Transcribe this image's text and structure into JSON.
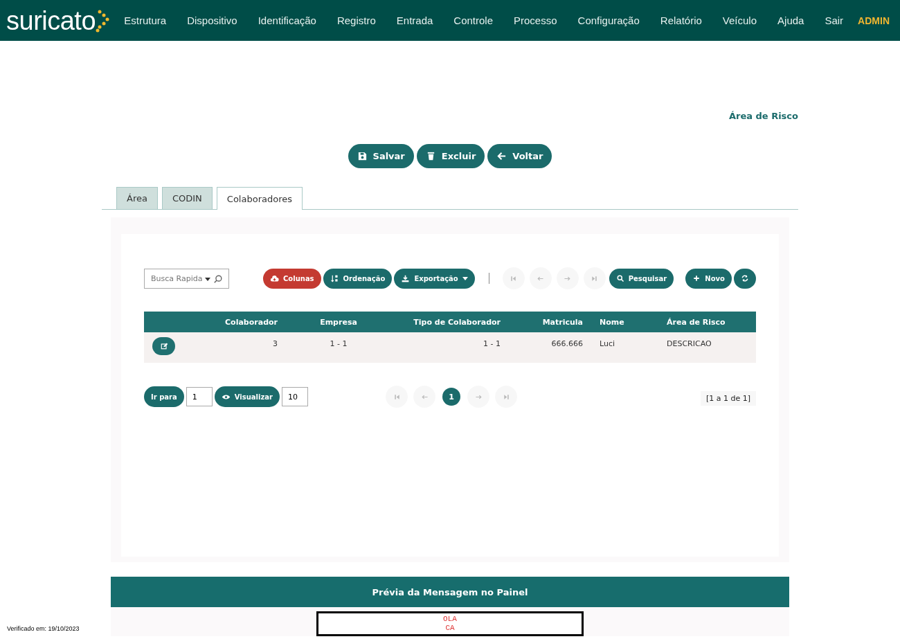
{
  "brand": {
    "name": "suricato"
  },
  "nav": [
    {
      "label": "Estrutura",
      "kind": "menu"
    },
    {
      "label": "Dispositivo",
      "kind": "menu"
    },
    {
      "label": "Identificação",
      "kind": "menu"
    },
    {
      "label": "Registro",
      "kind": "menu"
    },
    {
      "label": "Entrada",
      "kind": "menu"
    },
    {
      "label": "Controle",
      "kind": "menu"
    },
    {
      "label": "Processo",
      "kind": "menu"
    },
    {
      "label": "Configuração",
      "kind": "menu"
    },
    {
      "label": "Relatório",
      "kind": "menu"
    },
    {
      "label": "Veículo",
      "kind": "menu"
    },
    {
      "label": "Ajuda",
      "kind": "menu"
    },
    {
      "label": "Sair",
      "kind": "menu"
    },
    {
      "label": "ADMIN",
      "kind": "user"
    }
  ],
  "page_title": "Área de Risco",
  "actions": [
    {
      "label": "Salvar",
      "kind": "save"
    },
    {
      "label": "Excluir",
      "kind": "delete"
    },
    {
      "label": "Voltar",
      "kind": "back"
    }
  ],
  "tabs": [
    {
      "label": "Área",
      "selected": false
    },
    {
      "label": "CODIN",
      "selected": false
    },
    {
      "label": "Colaboradores",
      "selected": true
    }
  ],
  "toolbar": {
    "search": {
      "placeholder": "Busca Rapida"
    },
    "buttons": [
      {
        "label": "Colunas",
        "kind": "columns"
      },
      {
        "label": "Ordenação",
        "kind": "sort"
      },
      {
        "label": "Exportação",
        "kind": "export"
      }
    ],
    "nav": [
      {
        "kind": "first",
        "disabled": true
      },
      {
        "kind": "prev",
        "disabled": true
      },
      {
        "kind": "next",
        "disabled": true
      },
      {
        "kind": "last",
        "disabled": true
      }
    ],
    "search_button": {
      "label": "Pesquisar"
    },
    "right": [
      {
        "label": "Novo",
        "kind": "new"
      },
      {
        "kind": "refresh"
      }
    ]
  },
  "table": {
    "columns": [
      "Colaborador",
      "Empresa",
      "Tipo de Colaborador",
      "Matricula",
      "Nome",
      "Área de Risco"
    ],
    "rows": [
      {
        "cells": [
          "3",
          "1 - 1",
          "1 - 1",
          "666.666",
          "Luci",
          "DESCRICAO"
        ]
      }
    ]
  },
  "pager": {
    "goto_label": "Ir para",
    "goto_value": "1",
    "view_label": "Visualizar",
    "view_value": "10",
    "pages": [
      {
        "kind": "first",
        "disabled": true
      },
      {
        "kind": "prev",
        "disabled": true
      },
      {
        "kind": "page",
        "label": "1",
        "selected": true
      },
      {
        "kind": "next",
        "disabled": true
      },
      {
        "kind": "last",
        "disabled": true
      }
    ],
    "summary": "[1 a 1 de 1]"
  },
  "preview": {
    "title": "Prévia da Mensagem no Painel",
    "lines": [
      "OLA",
      "CA"
    ]
  },
  "footer": "Verificado em: 19/10/2023"
}
